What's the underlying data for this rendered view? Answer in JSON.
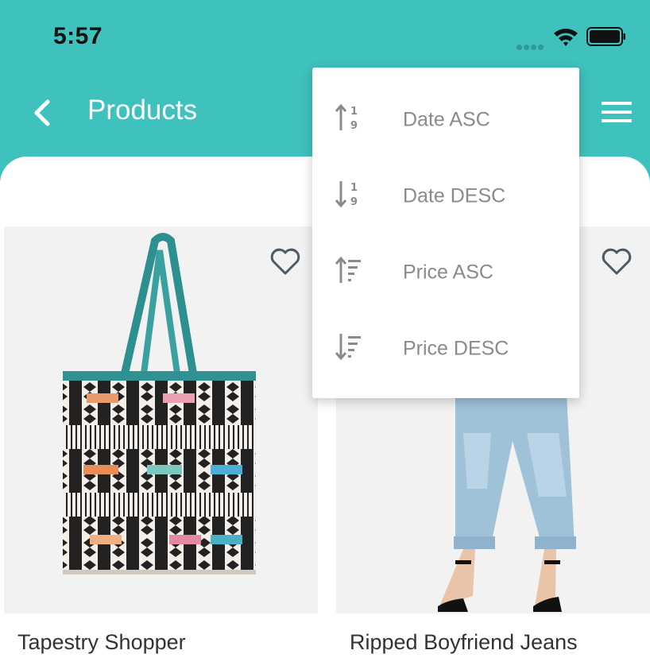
{
  "status_bar": {
    "time": "5:57"
  },
  "header": {
    "title": "Products"
  },
  "sort_menu": {
    "items": [
      {
        "label": "Date ASC",
        "icon": "sort-numeric-ascending-icon"
      },
      {
        "label": "Date DESC",
        "icon": "sort-numeric-descending-icon"
      },
      {
        "label": "Price ASC",
        "icon": "sort-amount-ascending-icon"
      },
      {
        "label": "Price DESC",
        "icon": "sort-amount-descending-icon"
      }
    ]
  },
  "products": [
    {
      "name": "Tapestry Shopper",
      "favorite": false
    },
    {
      "name": "Ripped Boyfriend Jeans",
      "favorite": false
    }
  ],
  "colors": {
    "accent": "#3fc1bd",
    "menu_text": "#8a8a8a",
    "heart_outline": "#4a5a66"
  }
}
